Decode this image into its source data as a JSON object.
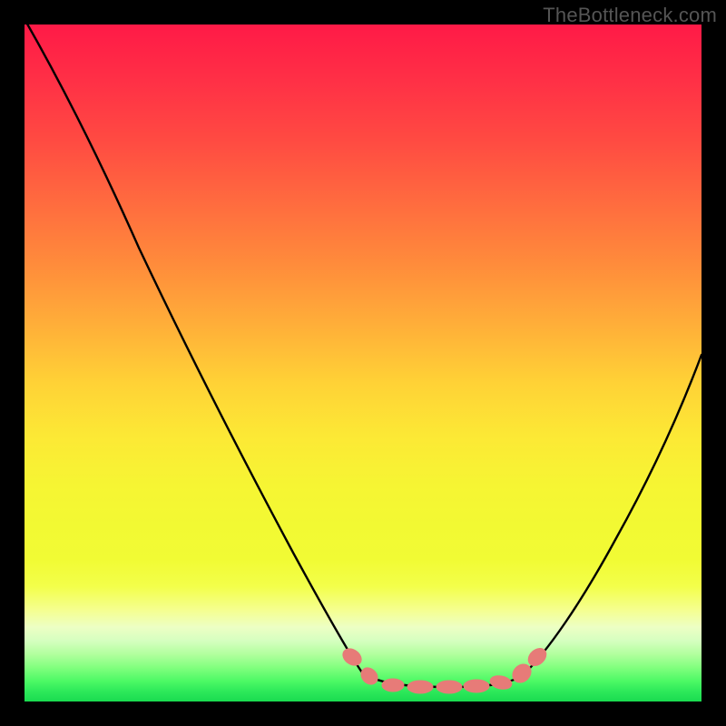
{
  "watermark": "TheBottleneck.com",
  "colors": {
    "curve": "#000000",
    "marker": "#e77b78",
    "gradient_top": "#ff1a47",
    "gradient_mid": "#fce935",
    "gradient_bottom": "#1adb50",
    "frame": "#000000"
  },
  "chart_data": {
    "type": "line",
    "title": "",
    "xlabel": "",
    "ylabel": "",
    "xlim": [
      0,
      100
    ],
    "ylim": [
      0,
      100
    ],
    "grid": false,
    "legend": false,
    "series": [
      {
        "name": "bottleneck-curve",
        "x": [
          0,
          5,
          10,
          15,
          20,
          25,
          30,
          35,
          40,
          45,
          48,
          50,
          55,
          60,
          63,
          67,
          70,
          74,
          78,
          82,
          86,
          90,
          95,
          100
        ],
        "y": [
          100,
          90,
          80,
          70,
          61,
          52,
          43,
          34,
          24,
          14,
          8,
          4,
          2,
          2,
          2,
          2,
          3,
          5,
          10,
          17,
          25,
          33,
          43,
          52
        ]
      }
    ],
    "annotations": [
      {
        "name": "optimal-range-markers",
        "style": "salmon-dashes",
        "x": [
          48,
          50,
          53,
          56,
          59,
          62,
          65,
          70,
          74,
          76
        ],
        "y": [
          6,
          4,
          3,
          2,
          2,
          2,
          2,
          3,
          5,
          7
        ]
      }
    ],
    "background": {
      "type": "vertical-heat-gradient",
      "meaning": "higher y = worse (red), lower y = better (green)"
    }
  }
}
